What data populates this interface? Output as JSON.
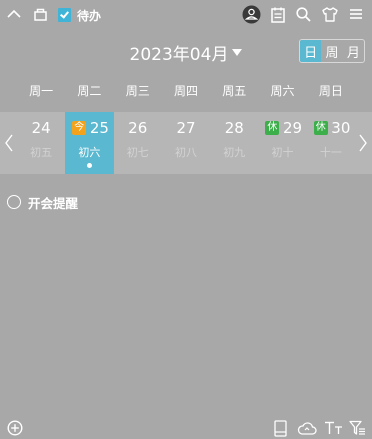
{
  "header": {
    "title": "待办",
    "icons": [
      "chevron-up-icon",
      "unpin-icon",
      "todo-check-icon",
      "user-icon",
      "note-icon",
      "search-icon",
      "skin-icon",
      "menu-icon"
    ]
  },
  "calendar": {
    "month_title": "2023年04月",
    "view_modes": [
      "日",
      "周",
      "月"
    ],
    "active_view": "日",
    "weekdays": [
      "周一",
      "周二",
      "周三",
      "周四",
      "周五",
      "周六",
      "周日"
    ],
    "days": [
      {
        "num": "24",
        "lunar": "初五",
        "badge": ""
      },
      {
        "num": "25",
        "lunar": "初六",
        "badge": "今",
        "selected": true,
        "has_event": true
      },
      {
        "num": "26",
        "lunar": "初七",
        "badge": ""
      },
      {
        "num": "27",
        "lunar": "初八",
        "badge": ""
      },
      {
        "num": "28",
        "lunar": "初九",
        "badge": ""
      },
      {
        "num": "29",
        "lunar": "初十",
        "badge": "休"
      },
      {
        "num": "30",
        "lunar": "十一",
        "badge": "休"
      }
    ]
  },
  "tasks": [
    {
      "label": "开会提醒",
      "done": false
    }
  ],
  "footer": {
    "icons": [
      "add-icon",
      "tablet-icon",
      "cloud-icon",
      "font-size-icon",
      "filter-icon"
    ]
  },
  "colors": {
    "background": "#a8a8a8",
    "accent": "#5ab8d1",
    "today_badge": "#f3a21b",
    "rest_badge": "#3cae4a"
  }
}
